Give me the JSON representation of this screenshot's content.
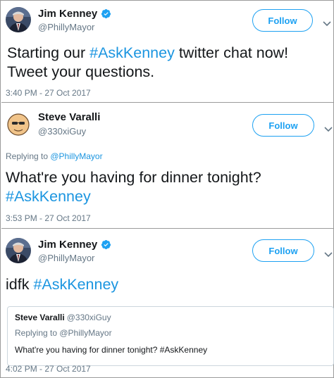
{
  "tweet1": {
    "name": "Jim Kenney",
    "handle": "@PhillyMayor",
    "follow_label": "Follow",
    "text_1": "Starting our ",
    "hashtag": "#AskKenney",
    "text_2": " twitter chat now!",
    "text_line2": "Tweet your questions.",
    "timestamp": "3:40 PM - 27 Oct 2017"
  },
  "tweet2": {
    "name": "Steve Varalli",
    "handle": "@330xiGuy",
    "follow_label": "Follow",
    "reply_prefix": "Replying to ",
    "reply_mention": "@PhillyMayor",
    "text_line1": "What're you having for dinner tonight?",
    "hashtag": "#AskKenney",
    "timestamp": "3:53 PM - 27 Oct 2017"
  },
  "tweet3": {
    "name": "Jim Kenney",
    "handle": "@PhillyMayor",
    "follow_label": "Follow",
    "text_1": "idfk ",
    "hashtag": "#AskKenney",
    "quote": {
      "name": "Steve Varalli",
      "handle": "@330xiGuy",
      "reply": "Replying to @PhillyMayor",
      "text": "What're you having for dinner tonight? #AskKenney"
    },
    "timestamp": "4:02 PM - 27 Oct 2017"
  },
  "colors": {
    "accent": "#1da1f2",
    "hashtag": "#1b95e0",
    "muted": "#657786",
    "border": "#9b9b9b"
  },
  "icons": [
    "verified-badge-icon",
    "chevron-down-icon"
  ]
}
